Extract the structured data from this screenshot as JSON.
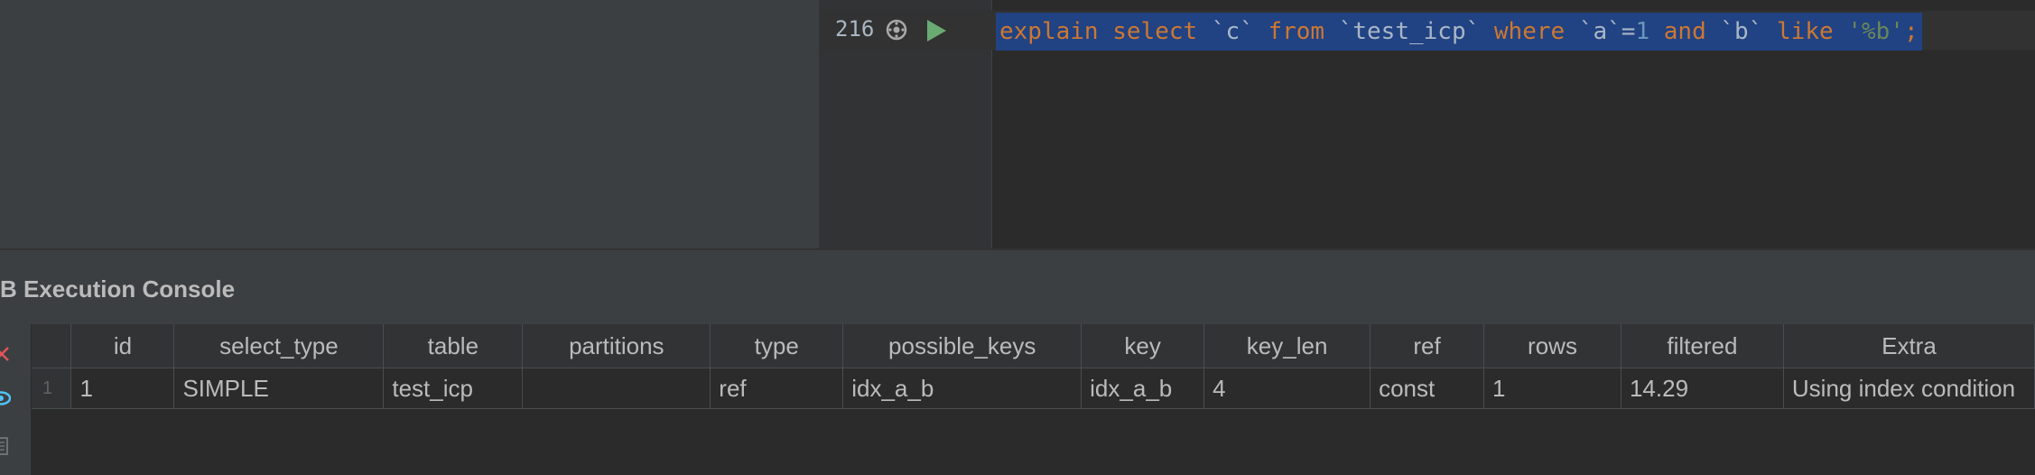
{
  "editor": {
    "line_number": "216",
    "tokens": [
      {
        "text": "explain",
        "kind": "kw"
      },
      {
        "text": " ",
        "kind": "id"
      },
      {
        "text": "select",
        "kind": "kw"
      },
      {
        "text": " `c` ",
        "kind": "id"
      },
      {
        "text": "from",
        "kind": "kw"
      },
      {
        "text": " `test_icp` ",
        "kind": "id"
      },
      {
        "text": "where",
        "kind": "kw"
      },
      {
        "text": " `a`=",
        "kind": "id"
      },
      {
        "text": "1",
        "kind": "num"
      },
      {
        "text": " ",
        "kind": "id"
      },
      {
        "text": "and",
        "kind": "kw"
      },
      {
        "text": " `b` ",
        "kind": "id"
      },
      {
        "text": "like",
        "kind": "kw"
      },
      {
        "text": " ",
        "kind": "id"
      },
      {
        "text": "'%b'",
        "kind": "str"
      },
      {
        "text": ";",
        "kind": "kw"
      }
    ]
  },
  "console": {
    "title": "B Execution Console"
  },
  "results": {
    "columns": [
      "id",
      "select_type",
      "table",
      "partitions",
      "type",
      "possible_keys",
      "key",
      "key_len",
      "ref",
      "rows",
      "filtered",
      "Extra"
    ],
    "rows": [
      {
        "row_number": "1",
        "cells": [
          "1",
          "SIMPLE",
          "test_icp",
          "",
          "ref",
          "idx_a_b",
          "idx_a_b",
          "4",
          "const",
          "1",
          "14.29",
          "Using index condition"
        ]
      }
    ]
  },
  "icons": {
    "gutter": [
      "gear-icon",
      "run-icon"
    ],
    "toolbar": [
      "close-icon",
      "eye-icon",
      "document-icon"
    ]
  },
  "colors": {
    "keyword": "#cc7832",
    "identifier": "#a9b7c6",
    "number": "#6897bb",
    "string": "#6a8759",
    "selection": "#214283",
    "run_green": "#6aab73",
    "close_red": "#e0555b",
    "eye_blue": "#4fc3f7"
  }
}
